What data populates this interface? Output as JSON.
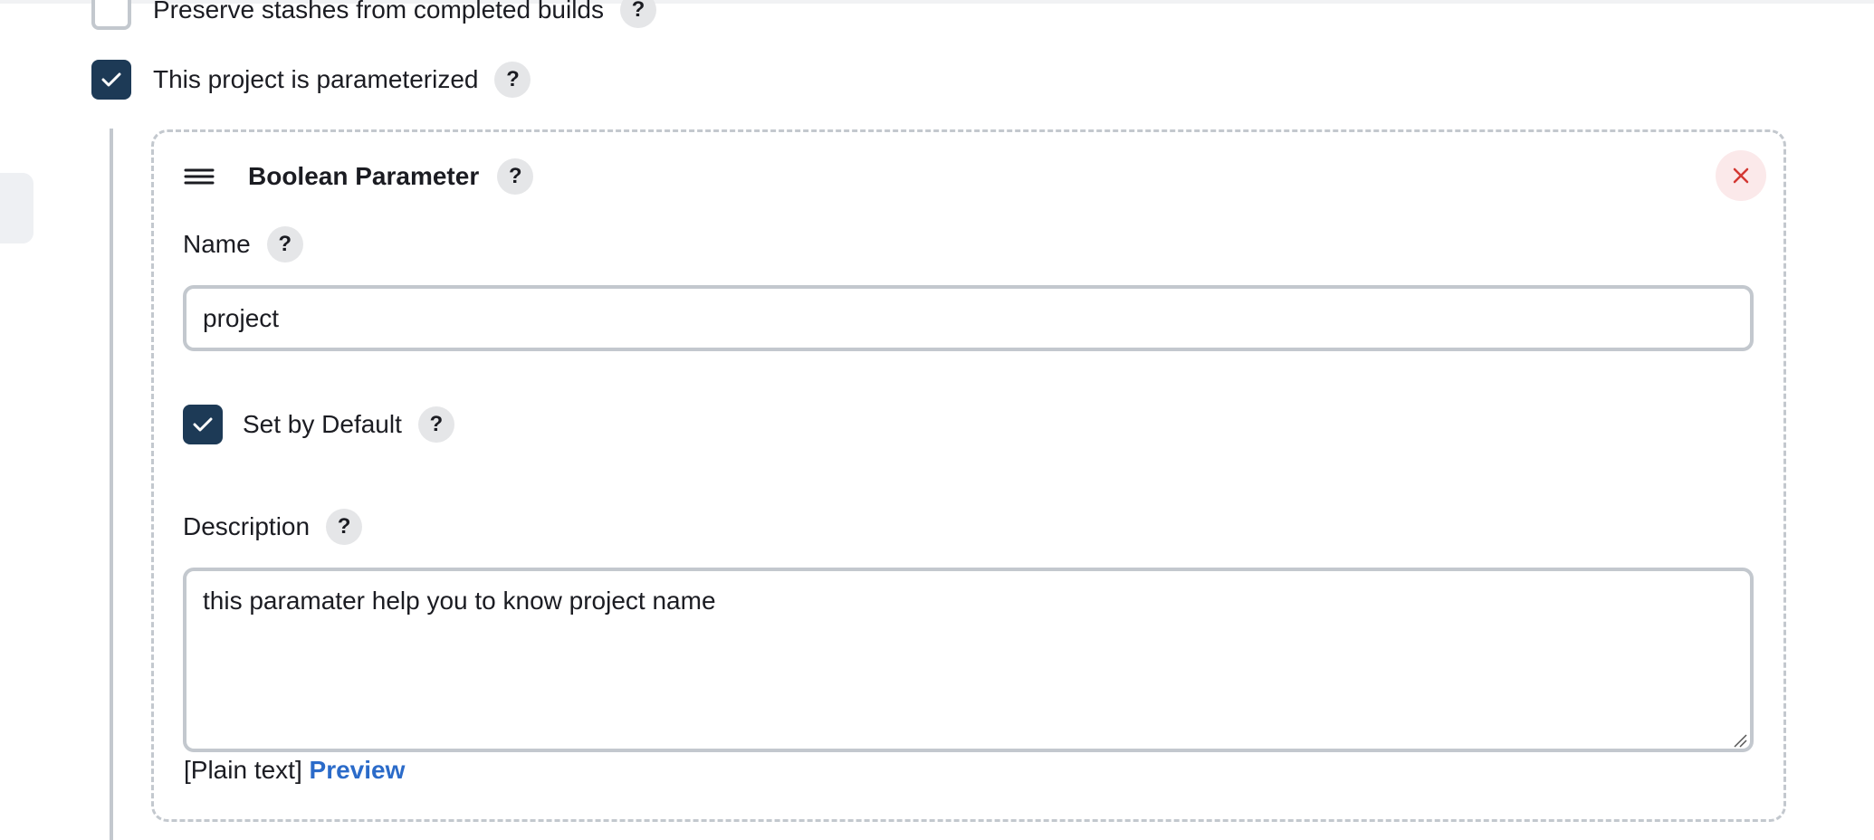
{
  "options": {
    "preserve_stashes": {
      "label": "Preserve stashes from completed builds",
      "checked": false
    },
    "parameterized": {
      "label": "This project is parameterized",
      "checked": true
    }
  },
  "help_glyph": "?",
  "parameter": {
    "title": "Boolean Parameter",
    "drag_icon": "drag-handle-icon",
    "close_icon": "close-icon",
    "name_label": "Name",
    "name_value": "project",
    "default_label": "Set by Default",
    "default_checked": true,
    "description_label": "Description",
    "description_value": "this paramater help you to know project name",
    "format_label": "[Plain text]",
    "preview_label": "Preview"
  },
  "colors": {
    "checkbox_checked": "#1d3a56",
    "checkbox_border": "#c3c8ce",
    "link": "#2b6bc9",
    "close_bg": "#fbe9ea",
    "close_x": "#d33833",
    "help_bg": "#e5e6e8"
  }
}
